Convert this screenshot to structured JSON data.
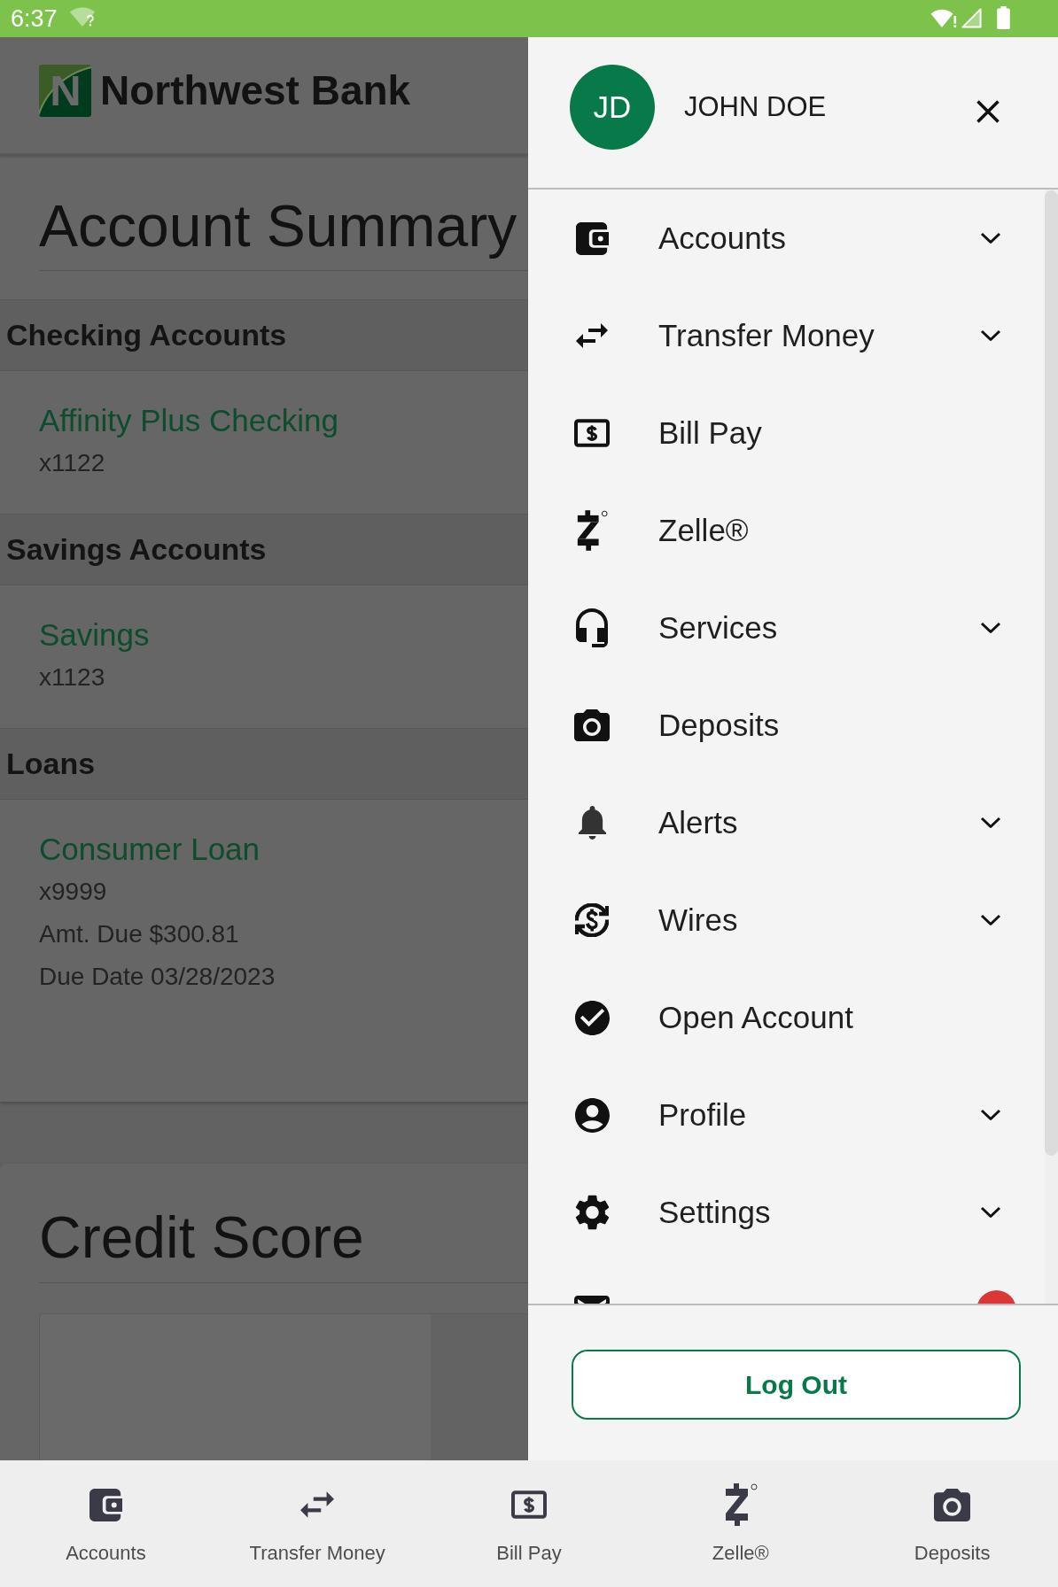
{
  "status_bar": {
    "time": "6:37"
  },
  "app_header": {
    "logo_letter": "N",
    "brand": "Northwest Bank"
  },
  "account_summary": {
    "title": "Account Summary",
    "sections": [
      {
        "heading": "Checking Accounts",
        "accounts": [
          {
            "name": "Affinity Plus Checking",
            "details": [
              "x1122"
            ]
          }
        ]
      },
      {
        "heading": "Savings Accounts",
        "accounts": [
          {
            "name": "Savings",
            "details": [
              "x1123"
            ]
          }
        ]
      },
      {
        "heading": "Loans",
        "accounts": [
          {
            "name": "Consumer Loan",
            "details": [
              "x9999",
              "Amt. Due $300.81",
              "Due Date 03/28/2023"
            ]
          }
        ]
      }
    ]
  },
  "credit_score": {
    "title": "Credit Score"
  },
  "drawer": {
    "user": {
      "initials": "JD",
      "name": "JOHN DOE"
    },
    "items": [
      {
        "label": "Accounts",
        "expandable": true,
        "badge": false
      },
      {
        "label": "Transfer Money",
        "expandable": true,
        "badge": false
      },
      {
        "label": "Bill Pay",
        "expandable": false,
        "badge": false
      },
      {
        "label": "Zelle®",
        "expandable": false,
        "badge": false
      },
      {
        "label": "Services",
        "expandable": true,
        "badge": false
      },
      {
        "label": "Deposits",
        "expandable": false,
        "badge": false
      },
      {
        "label": "Alerts",
        "expandable": true,
        "badge": false
      },
      {
        "label": "Wires",
        "expandable": true,
        "badge": false
      },
      {
        "label": "Open Account",
        "expandable": false,
        "badge": false
      },
      {
        "label": "Profile",
        "expandable": true,
        "badge": false
      },
      {
        "label": "Settings",
        "expandable": true,
        "badge": false
      },
      {
        "expandable": false,
        "badge": true
      }
    ],
    "logout": "Log Out"
  },
  "bottom_nav": [
    {
      "label": "Accounts",
      "selected": false
    },
    {
      "label": "Transfer Money",
      "selected": false
    },
    {
      "label": "Bill Pay",
      "selected": false
    },
    {
      "label": "Zelle®",
      "selected": false
    },
    {
      "label": "Deposits",
      "selected": false
    }
  ]
}
